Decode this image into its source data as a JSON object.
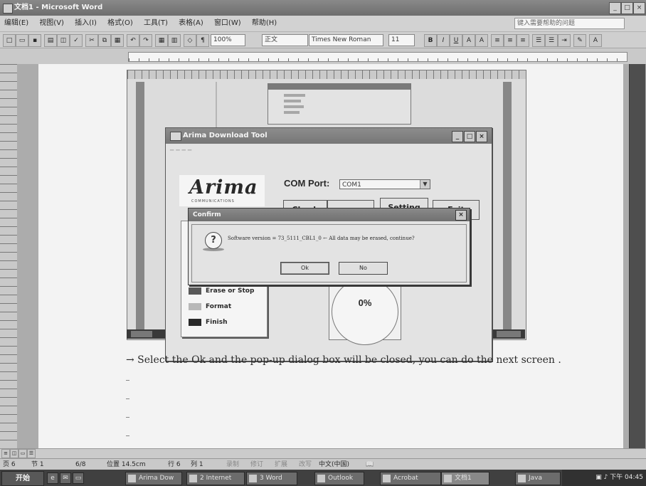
{
  "window": {
    "title": "文档1 - Microsoft Word"
  },
  "menubar": {
    "items": [
      "编辑(E)",
      "视图(V)",
      "插入(I)",
      "格式(O)",
      "工具(T)",
      "表格(A)",
      "窗口(W)",
      "帮助(H)"
    ],
    "help_placeholder": "键入需要帮助的问题"
  },
  "toolbar": {
    "style_value": "正文",
    "font_value": "Times New Roman",
    "size_value": "11",
    "zoom_value": "100%"
  },
  "tool_dialog": {
    "title": "Arima Download Tool",
    "logo_text": "Arima",
    "logo_subtext": "COMMUNICATIONS",
    "com_label": "COM Port:",
    "com_value": "COM1",
    "buttons": [
      "Check",
      "",
      "Setting",
      "Exit"
    ],
    "legend": [
      "Erase or Stop",
      "Format",
      "Finish"
    ],
    "progress": "0%"
  },
  "confirm_dialog": {
    "title": "Confirm",
    "message": "Software version = 73_5111_CBL1_0  ← All data may be erased, continue?",
    "ok_label": "Ok",
    "no_label": "No"
  },
  "document": {
    "line_text": "→ Select the Ok and the pop-up dialog box will be closed, you can do the next screen ."
  },
  "statusbar": {
    "items": [
      "页 6",
      "节 1",
      "6/8",
      "位置 14.5cm",
      "行 6",
      "列 1",
      "录制",
      "修订",
      "扩展",
      "改写",
      "中文(中国)"
    ]
  },
  "taskbar": {
    "start_label": "开始",
    "tasks": [
      "Arima Dow",
      "2 Internet",
      "3 Word",
      "Outlook",
      "Acrobat",
      "文档1",
      "Java"
    ],
    "clock": "下午 04:45"
  }
}
